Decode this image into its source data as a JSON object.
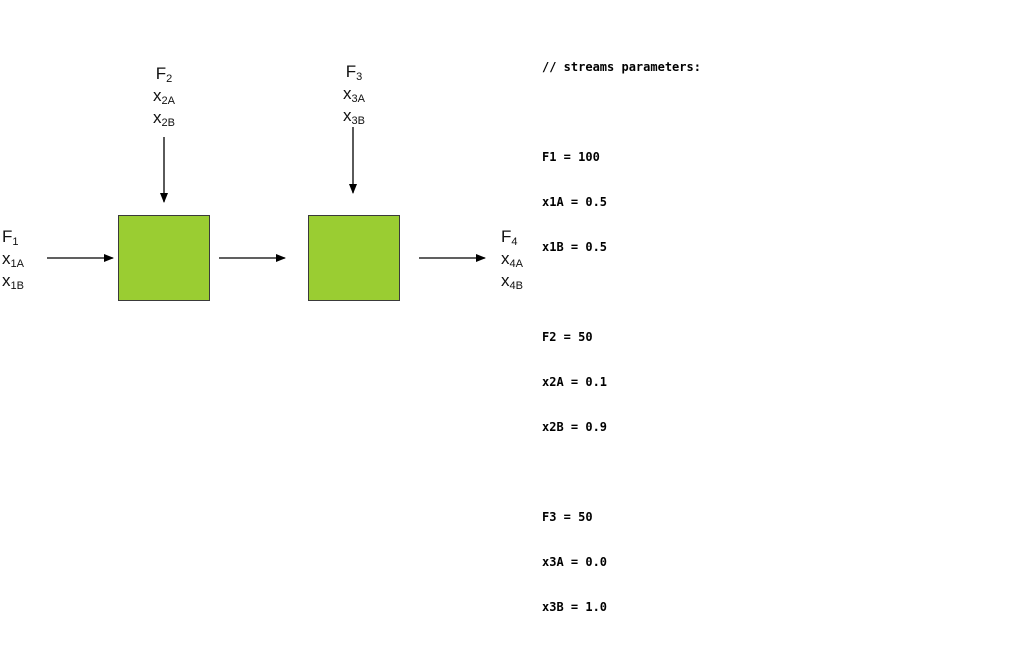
{
  "colors": {
    "block_fill": "#9acd32",
    "block_border": "#3a3a3a",
    "arrow": "#000000"
  },
  "streams": {
    "s1": {
      "flow": {
        "base": "F",
        "sub": "1"
      },
      "xa": {
        "base": "x",
        "sub": "1A"
      },
      "xb": {
        "base": "x",
        "sub": "1B"
      }
    },
    "s2": {
      "flow": {
        "base": "F",
        "sub": "2"
      },
      "xa": {
        "base": "x",
        "sub": "2A"
      },
      "xb": {
        "base": "x",
        "sub": "2B"
      }
    },
    "s3": {
      "flow": {
        "base": "F",
        "sub": "3"
      },
      "xa": {
        "base": "x",
        "sub": "3A"
      },
      "xb": {
        "base": "x",
        "sub": "3B"
      }
    },
    "s4": {
      "flow": {
        "base": "F",
        "sub": "4"
      },
      "xa": {
        "base": "x",
        "sub": "4A"
      },
      "xb": {
        "base": "x",
        "sub": "4B"
      }
    }
  },
  "parameters": {
    "comment": "// streams parameters:",
    "groups": [
      [
        "F1 = 100",
        "x1A = 0.5",
        "x1B = 0.5"
      ],
      [
        "F2 = 50",
        "x2A = 0.1",
        "x2B = 0.9"
      ],
      [
        "F3 = 50",
        "x3A = 0.0",
        "x3B = 1.0"
      ]
    ]
  }
}
